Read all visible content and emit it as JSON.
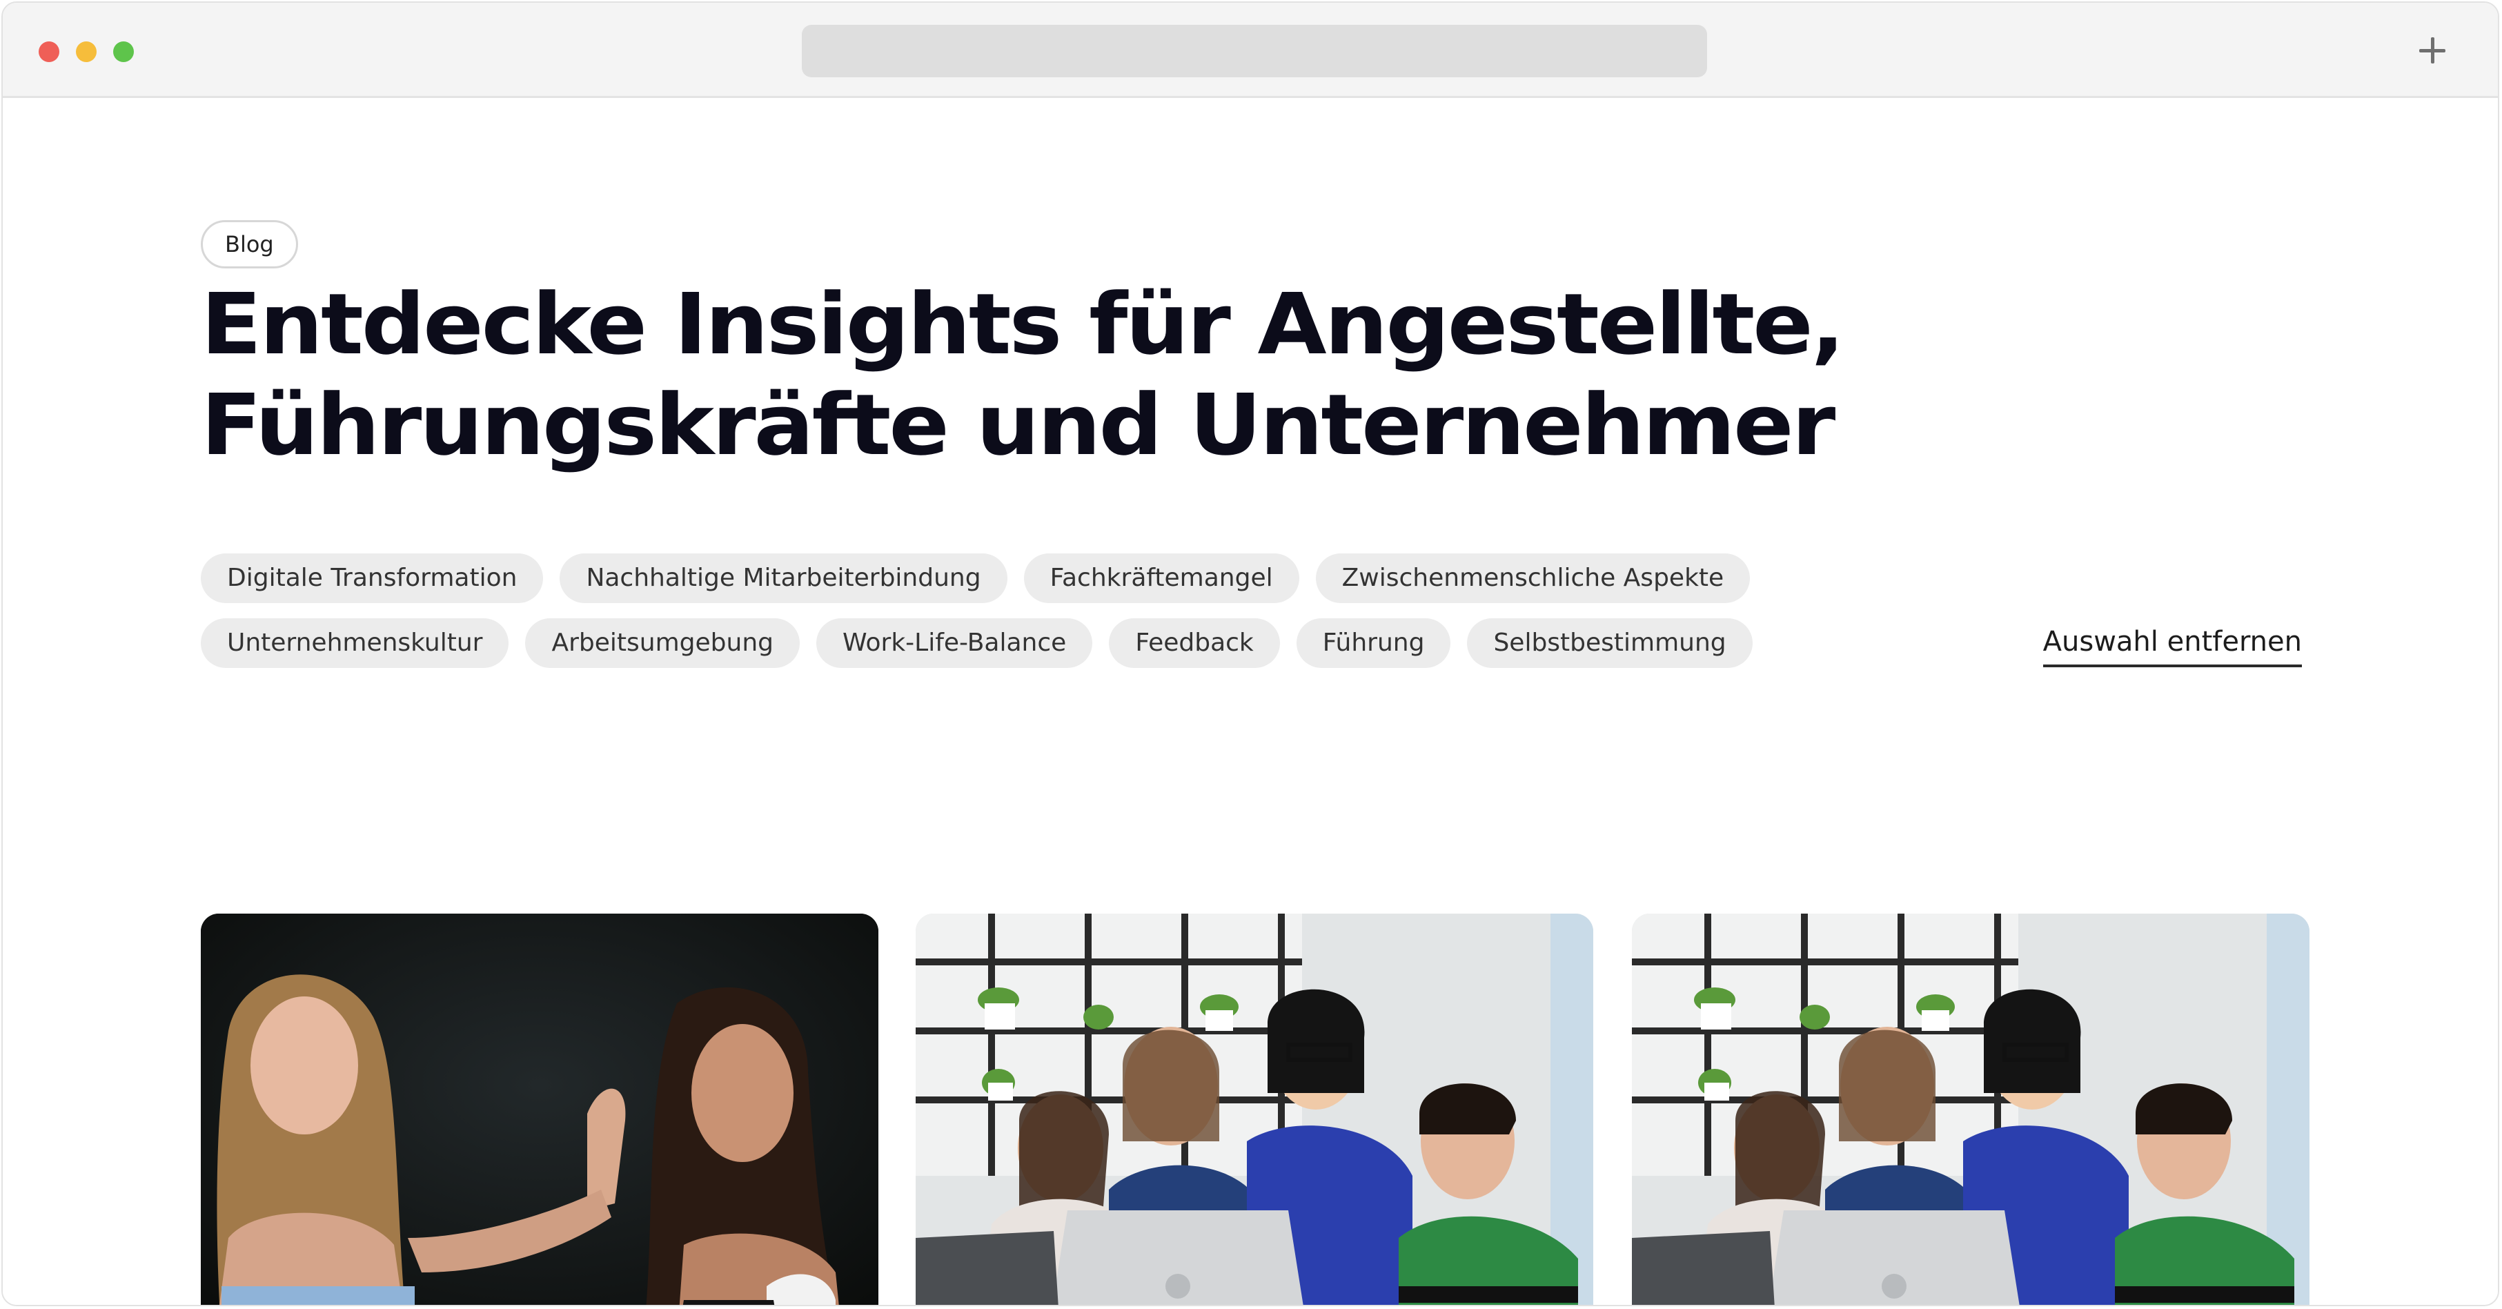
{
  "page": {
    "badge": "Blog",
    "headline": {
      "line1": "Entdecke Insights für Angestellte,",
      "line2": "Führungskräfte und Unternehmer"
    },
    "filters": {
      "row1": [
        "Digitale Transformation",
        "Nachhaltige Mitarbeiterbindung",
        "Fachkräftemangel",
        "Zwischenmenschliche Aspekte"
      ],
      "row2": [
        "Unternehmenskultur",
        "Arbeitsumgebung",
        "Work-Life-Balance",
        "Feedback",
        "Führung",
        "Selbstbestimmung"
      ]
    },
    "clear_selection": "Auswahl entfernen"
  },
  "cards": [
    {
      "image": "two-women-gesture-photo"
    },
    {
      "image": "team-laptop-office-photo"
    },
    {
      "image": "team-laptop-office-photo"
    }
  ],
  "colors": {
    "headline": "#0c0c1a",
    "chip_background": "#ececec",
    "traffic_red": "#ef5f57",
    "traffic_yellow": "#f6bd3b",
    "traffic_green": "#5ec44b"
  }
}
